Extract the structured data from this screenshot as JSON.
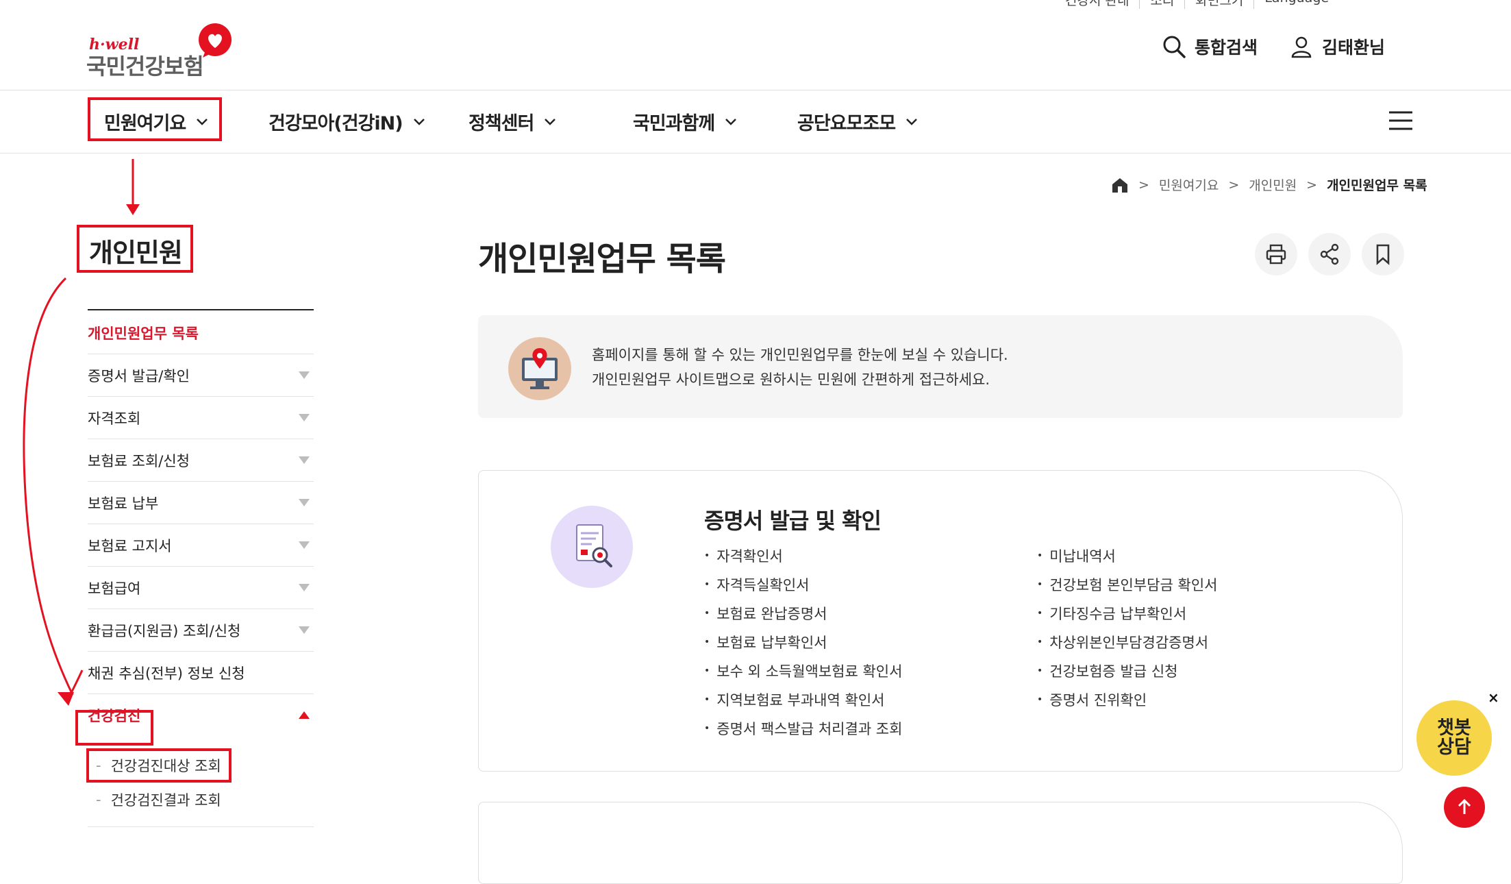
{
  "utility": [
    "건강서 관내",
    "소리",
    "화면크기",
    "Language"
  ],
  "logo": {
    "brand_small": "h·well",
    "brand_name": "국민건강보험"
  },
  "header": {
    "search_label": "통합검색",
    "user_label": "김태환님"
  },
  "gnb": [
    "민원여기요",
    "건강모아(건강iN)",
    "정책센터",
    "국민과함께",
    "공단요모조모"
  ],
  "breadcrumb": [
    "민원여기요",
    "개인민원",
    "개인민원업무 목록"
  ],
  "page": {
    "title": "개인민원업무 목록"
  },
  "info": {
    "line1": "홈페이지를 통해 할 수 있는 개인민원업무를 한눈에 보실 수 있습니다.",
    "line2": "개인민원업무 사이트맵으로 원하시는 민원에 간편하게 접근하세요."
  },
  "sidebar": {
    "title": "개인민원",
    "items": [
      "개인민원업무 목록",
      "증명서 발급/확인",
      "자격조회",
      "보험료 조회/신청",
      "보험료 납부",
      "보험료 고지서",
      "보험급여",
      "환급금(지원금) 조회/신청",
      "채권 추심(전부) 정보 신청",
      "건강검진"
    ],
    "subitems": [
      "건강검진대상 조회",
      "건강검진결과 조회"
    ]
  },
  "card": {
    "title": "증명서 발급 및 확인",
    "left": [
      "자격확인서",
      "자격득실확인서",
      "보험료 완납증명서",
      "보험료 납부확인서",
      "보수 외 소득월액보험료 확인서",
      "지역보험료 부과내역 확인서",
      "증명서 팩스발급 처리결과 조회"
    ],
    "right": [
      "미납내역서",
      "건강보험 본인부담금 확인서",
      "기타징수금 납부확인서",
      "차상위본인부담경감증명서",
      "건강보험증 발급 신청",
      "증명서 진위확인"
    ]
  },
  "chatbot": {
    "line1": "챗봇",
    "line2": "상담",
    "close": "×"
  },
  "colors": {
    "accent": "#e41220",
    "annotation": "#e41220"
  }
}
